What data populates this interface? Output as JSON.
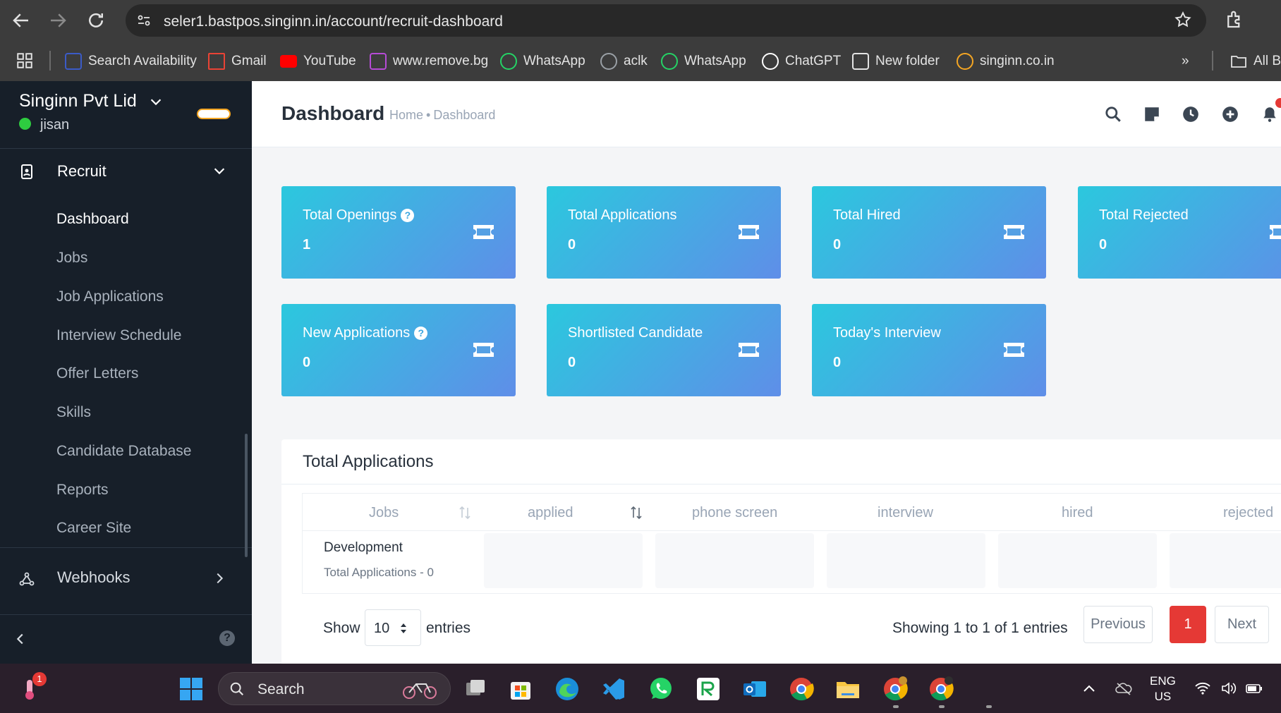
{
  "browser": {
    "url": "seler1.bastpos.singinn.in/account/recruit-dashboard",
    "bookmarks": [
      {
        "label": "Search Availability",
        "icon": "irctc-icon",
        "color": "#3b5bc7"
      },
      {
        "label": "Gmail",
        "icon": "gmail-icon",
        "color": "#ea4335"
      },
      {
        "label": "YouTube",
        "icon": "youtube-icon",
        "color": "#ff0000"
      },
      {
        "label": "www.remove.bg",
        "icon": "removebg-icon",
        "color": "#b64bd6"
      },
      {
        "label": "WhatsApp",
        "icon": "whatsapp-icon",
        "color": "#25d366"
      },
      {
        "label": "aclk",
        "icon": "globe-icon",
        "color": "#9aa0a6"
      },
      {
        "label": "WhatsApp",
        "icon": "whatsapp-icon",
        "color": "#25d366"
      },
      {
        "label": "ChatGPT",
        "icon": "chatgpt-icon",
        "color": "#ffffff"
      },
      {
        "label": "New folder",
        "icon": "folder-icon",
        "color": "#e3e3e3"
      },
      {
        "label": "singinn.co.in",
        "icon": "singinn-icon",
        "color": "#f5a623"
      }
    ],
    "overflow_label": "»",
    "all_bookmarks_label": "All B"
  },
  "sidebar": {
    "company": "Singinn Pvt Lid",
    "user": "jisan",
    "menu_head": "Recruit",
    "items": [
      {
        "label": "Dashboard",
        "active": true
      },
      {
        "label": "Jobs"
      },
      {
        "label": "Job Applications"
      },
      {
        "label": "Interview Schedule"
      },
      {
        "label": "Offer Letters"
      },
      {
        "label": "Skills"
      },
      {
        "label": "Candidate Database"
      },
      {
        "label": "Reports"
      },
      {
        "label": "Career Site"
      }
    ],
    "webhooks": "Webhooks",
    "help": "?"
  },
  "header": {
    "title": "Dashboard",
    "breadcrumb": [
      "Home",
      "Dashboard"
    ],
    "breadcrumb_sep": "•"
  },
  "cards": [
    {
      "title": "Total Openings",
      "value": "1",
      "help": true
    },
    {
      "title": "Total Applications",
      "value": "0",
      "help": false
    },
    {
      "title": "Total Hired",
      "value": "0",
      "help": false
    },
    {
      "title": "Total Rejected",
      "value": "0",
      "help": false
    },
    {
      "title": "New Applications",
      "value": "0",
      "help": true
    },
    {
      "title": "Shortlisted Candidate",
      "value": "0",
      "help": false
    },
    {
      "title": "Today's Interview",
      "value": "0",
      "help": false
    }
  ],
  "applications": {
    "title": "Total Applications",
    "columns": [
      "Jobs",
      "applied",
      "phone screen",
      "interview",
      "hired",
      "rejected"
    ],
    "rows": [
      {
        "job": "Development",
        "sub": "Total Applications - 0"
      }
    ],
    "show_label": "Show",
    "entries_value": "10",
    "entries_label": "entries",
    "showing": "Showing 1 to 1 of 1 entries",
    "prev": "Previous",
    "page": "1",
    "next": "Next"
  },
  "taskbar": {
    "search": "Search",
    "badge": "1",
    "lang_top": "ENG",
    "lang_bottom": "US"
  },
  "colors": {
    "sidebar_bg": "#171f29",
    "card_gradient_start": "#2bc8de",
    "card_gradient_end": "#5f8ee8",
    "accent_red": "#e53935"
  }
}
